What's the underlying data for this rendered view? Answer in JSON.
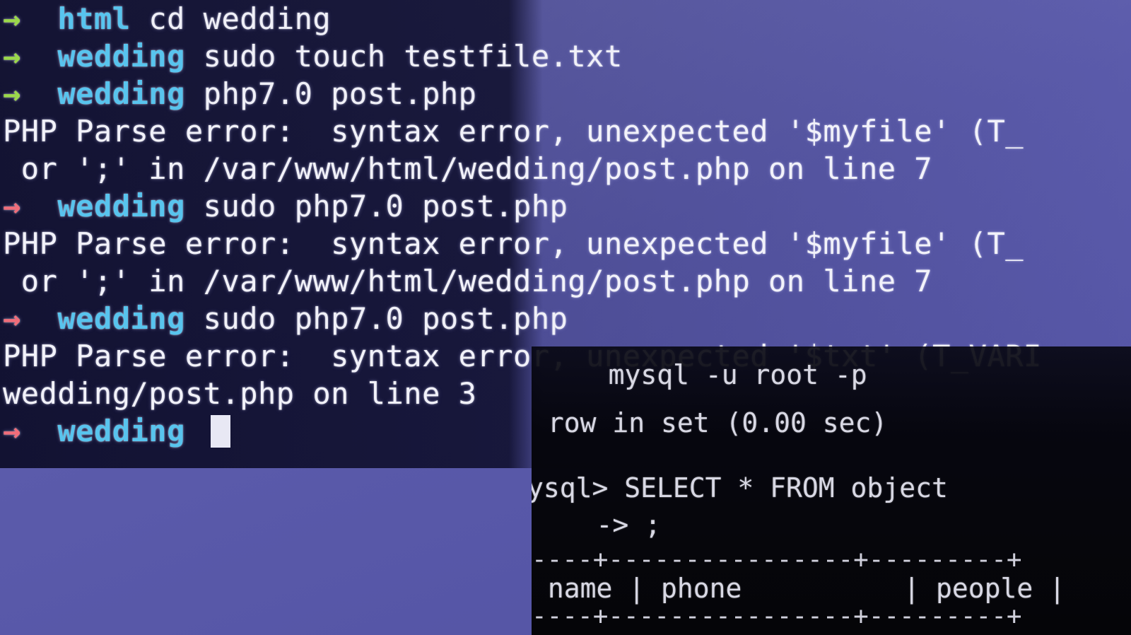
{
  "main_terminal": {
    "lines": [
      {
        "arrow": "→",
        "dir": "html",
        "cmd": " cd wedding"
      },
      {
        "arrow": "→",
        "dir": "wedding",
        "cmd": " sudo touch testfile.txt"
      },
      {
        "arrow": "→",
        "dir": "wedding",
        "cmd": " php7.0 post.php"
      },
      {
        "text": "PHP Parse error:  syntax error, unexpected '$myfile' (T_"
      },
      {
        "text": " or ';' in /var/www/html/wedding/post.php on line 7"
      },
      {
        "arrow": "→",
        "dir": "wedding",
        "cmd": " sudo php7.0 post.php"
      },
      {
        "text": "PHP Parse error:  syntax error, unexpected '$myfile' (T_"
      },
      {
        "text": " or ';' in /var/www/html/wedding/post.php on line 7"
      },
      {
        "arrow": "→",
        "dir": "wedding",
        "cmd": " sudo php7.0 post.php"
      },
      {
        "text": "PHP Parse error:  syntax error, unexpected '$txt' (T_VARI"
      },
      {
        "text": "wedding/post.php on line 3"
      },
      {
        "arrow": "→",
        "dir": "wedding",
        "cmd": " "
      }
    ],
    "colors": {
      "arrow_ok": "#9bd84a",
      "arrow_err": "#f06d7a",
      "dir": "#58c4ee"
    }
  },
  "mysql_terminal": {
    "faded_line": "   mysql -u root -p",
    "result_line": " row in set (0.00 sec)",
    "prompt_line": "ysql> SELECT * FROM object",
    "continuation_line": "    -> ;",
    "table_border_top": "----+----------------+---------+",
    "table_header": " name | phone          | people |",
    "table_border_bottom": "----+----------------+---------+"
  }
}
